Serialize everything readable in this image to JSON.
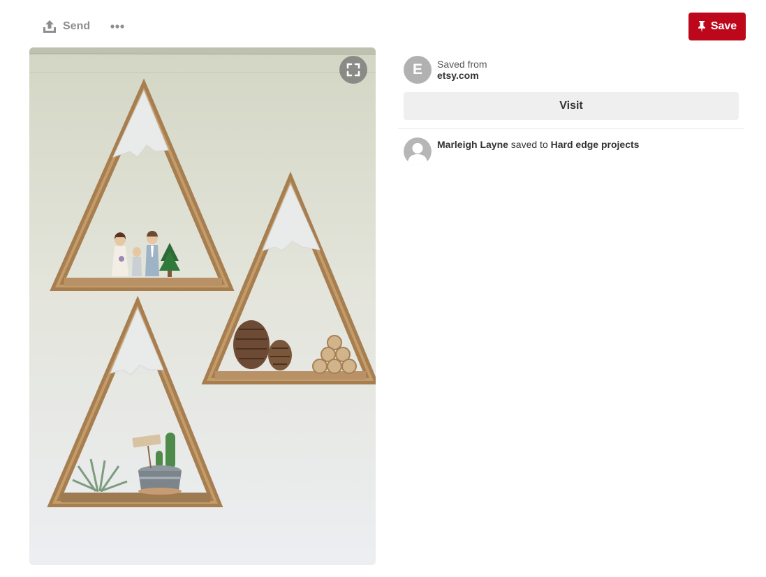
{
  "toolbar": {
    "send_label": "Send",
    "save_label": "Save",
    "save_color": "#bd081c"
  },
  "icons": {
    "send": "upload-arrow-icon",
    "more": "ellipsis-icon",
    "save": "pushpin-icon",
    "expand": "expand-icon",
    "user": "person-silhouette-icon"
  },
  "source": {
    "avatar_letter": "E",
    "label": "Saved from",
    "domain": "etsy.com"
  },
  "visit": {
    "label": "Visit"
  },
  "attribution": {
    "user_name": "Marleigh Layne",
    "connector": " saved to ",
    "board_name": "Hard edge projects"
  }
}
